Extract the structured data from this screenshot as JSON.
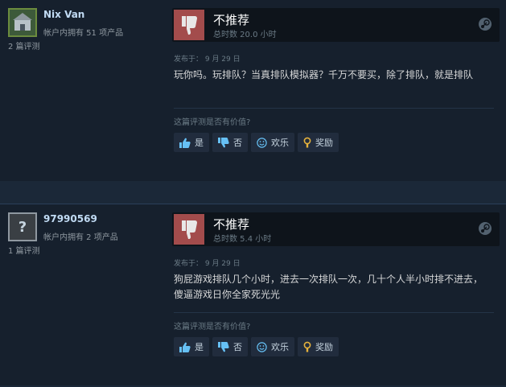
{
  "reviews": [
    {
      "username": "Nix Van",
      "owned": "帐户内拥有 51 项产品",
      "review_count": "2 篇评测",
      "recommendation": "不推荐",
      "hours": "总时数 20.0 小时",
      "posted": "发布于： 9 月 29 日",
      "text": "玩你吗。玩排队？当真排队模拟器？千万不要买，除了排队，就是排队",
      "helpful_q": "这篇评测是否有价值?",
      "buttons": {
        "yes": "是",
        "no": "否",
        "funny": "欢乐",
        "award": "奖励"
      }
    },
    {
      "username": "97990569",
      "owned": "帐户内拥有 2 项产品",
      "review_count": "1 篇评测",
      "recommendation": "不推荐",
      "hours": "总时数 5.4 小时",
      "posted": "发布于： 9 月 29 日",
      "text": "狗屁游戏排队几个小时，进去一次排队一次，几十个人半小时排不进去，傻逼游戏日你全家死光光",
      "helpful_q": "这篇评测是否有价值?",
      "buttons": {
        "yes": "是",
        "no": "否",
        "funny": "欢乐",
        "award": "奖励"
      }
    }
  ],
  "colors": {
    "background": "#1b2838",
    "panel": "#16202d",
    "thumb_down": "#a34c4c",
    "link": "#c1dbf4"
  },
  "icons": [
    "thumbs-down-icon",
    "steam-icon",
    "thumbs-up-icon",
    "smiley-icon",
    "award-icon",
    "unknown-avatar-icon"
  ]
}
